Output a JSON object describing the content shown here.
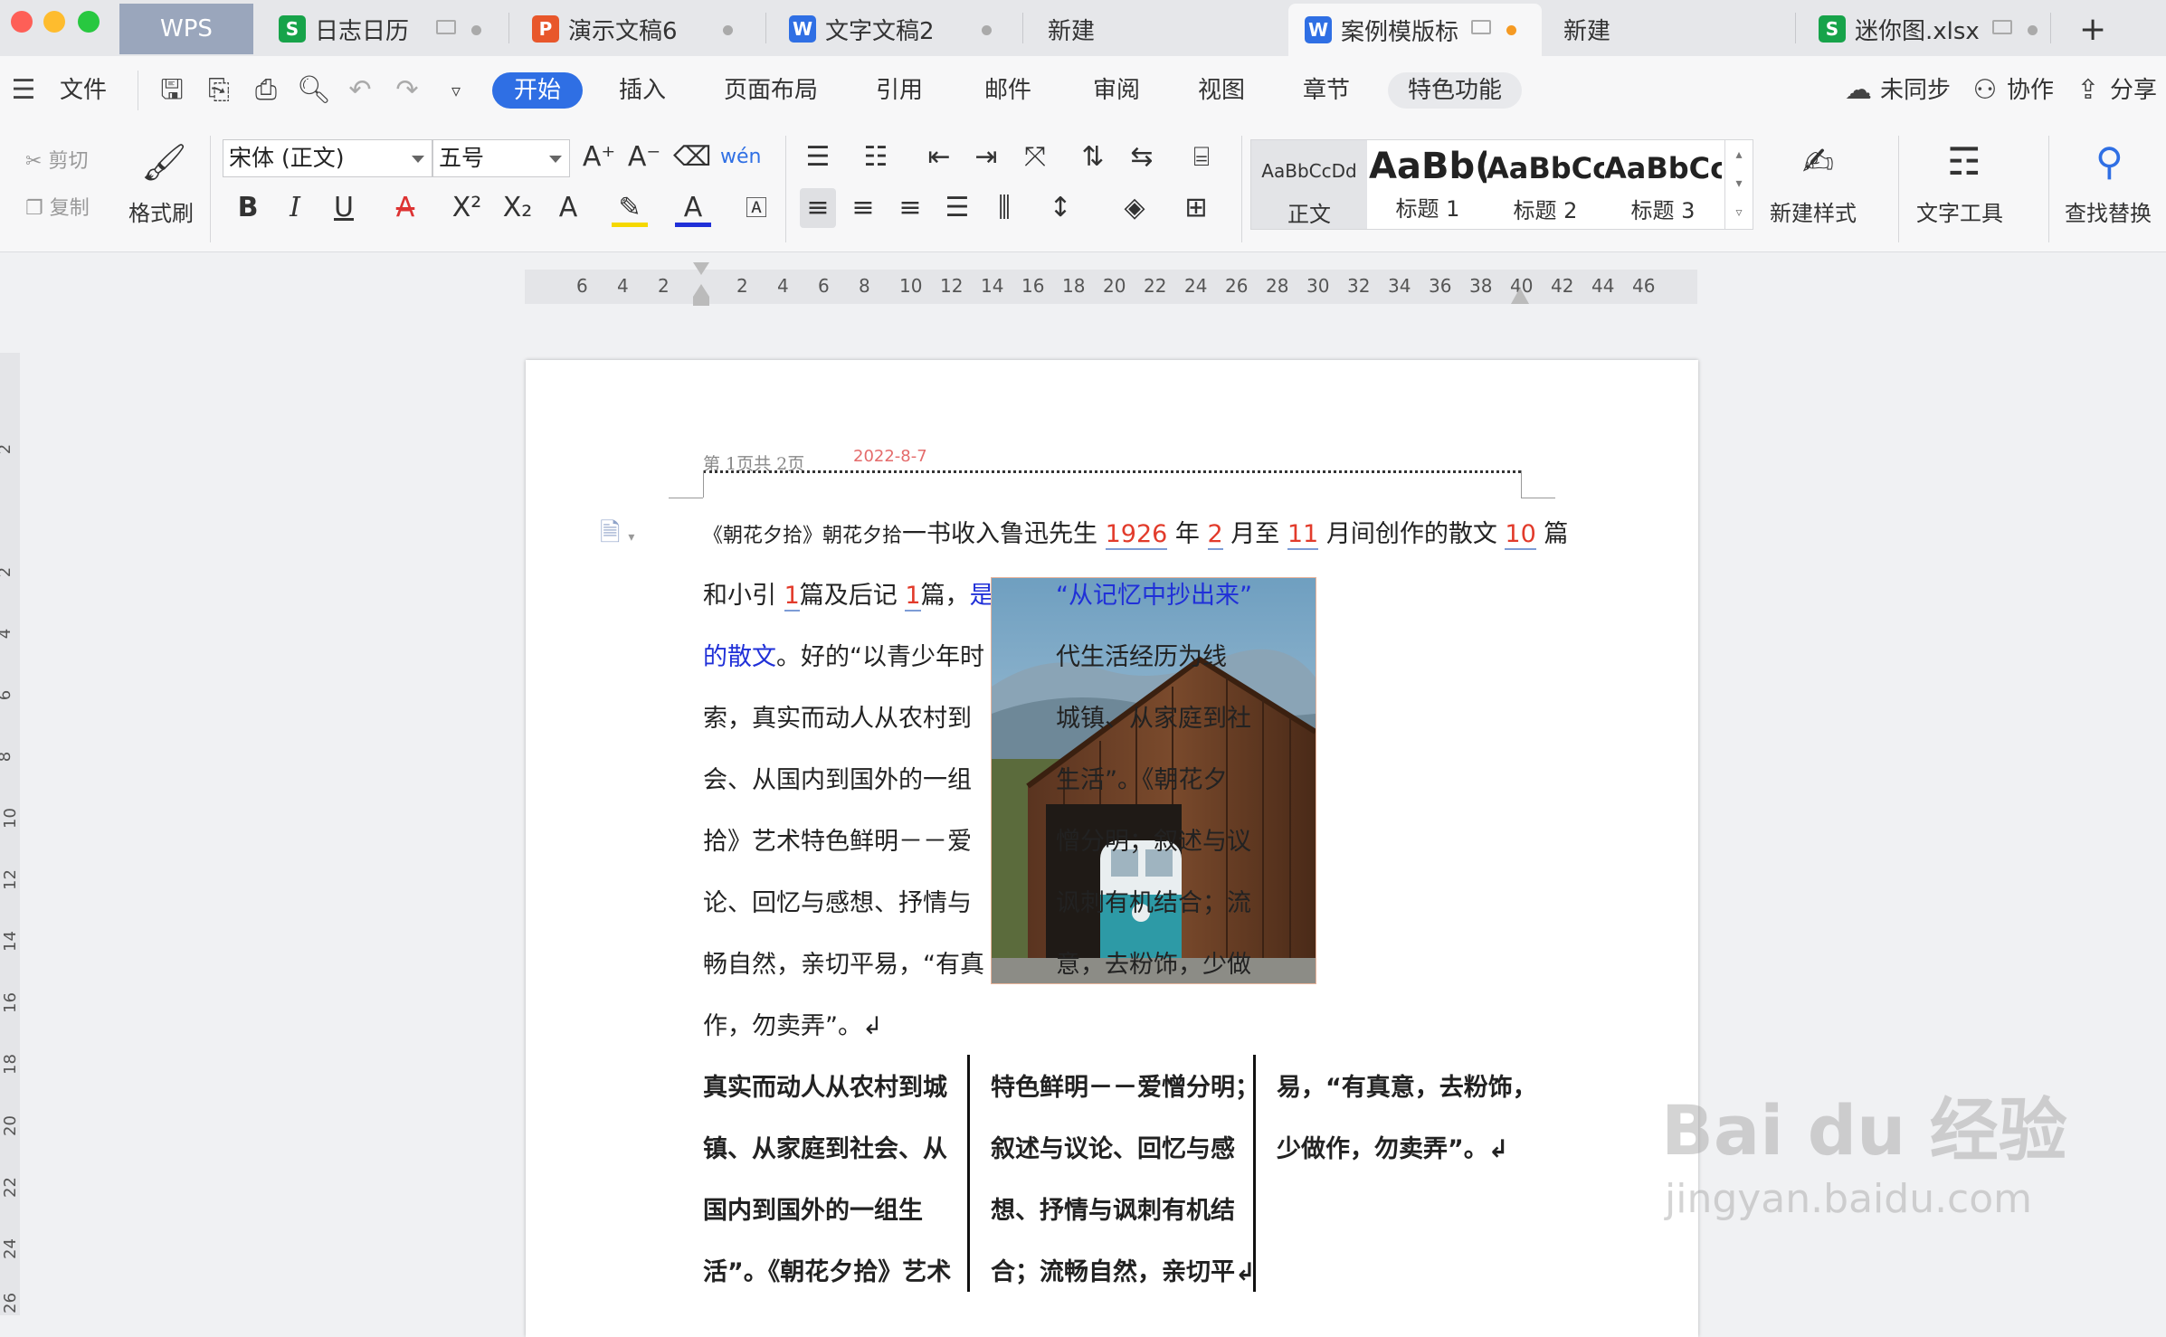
{
  "tabs": {
    "wps": "WPS",
    "items": [
      {
        "label": "日志日历",
        "icon": "S",
        "color": "#17a34a"
      },
      {
        "label": "演示文稿6",
        "icon": "P",
        "color": "#e8572b"
      },
      {
        "label": "文字文稿2",
        "icon": "W",
        "color": "#2f6fe4"
      },
      {
        "label": "新建"
      },
      {
        "label": "案例模版标",
        "icon": "W",
        "color": "#2f6fe4",
        "active": true
      },
      {
        "label": "新建"
      },
      {
        "label": "迷你图.xlsx",
        "icon": "S",
        "color": "#17a34a"
      }
    ],
    "add": "+"
  },
  "menubar": {
    "file": "文件",
    "items": [
      "开始",
      "插入",
      "页面布局",
      "引用",
      "邮件",
      "审阅",
      "视图",
      "章节",
      "特色功能"
    ],
    "unsync": "未同步",
    "collab": "协作",
    "share": "分享"
  },
  "ribbon": {
    "cut": "剪切",
    "copy": "复制",
    "format_painter": "格式刷",
    "font": "宋体 (正文)",
    "size": "五号",
    "styles": [
      {
        "preview": "AaBbCcDd",
        "name": "正文"
      },
      {
        "preview": "AaBb(",
        "name": "标题 1"
      },
      {
        "preview": "AaBbCc",
        "name": "标题 2"
      },
      {
        "preview": "AaBbCc",
        "name": "标题 3"
      }
    ],
    "new_style": "新建样式",
    "text_tools": "文字工具",
    "find_replace": "查找替换"
  },
  "ruler": {
    "h": [
      "6",
      "4",
      "2",
      "2",
      "4",
      "6",
      "8",
      "10",
      "12",
      "14",
      "16",
      "18",
      "20",
      "22",
      "24",
      "26",
      "28",
      "30",
      "32",
      "34",
      "36",
      "38",
      "40",
      "42",
      "44",
      "46"
    ],
    "v": [
      "2",
      "2",
      "4",
      "6",
      "8",
      "10",
      "12",
      "14",
      "16",
      "18",
      "20",
      "22",
      "24",
      "26"
    ]
  },
  "document": {
    "header_page": "第 1页共 2页",
    "header_date": "2022-8-7",
    "line1": {
      "a": "《朝花夕拾》",
      "b": "朝花夕拾",
      "c": "一书收入鲁迅先生 ",
      "y": "1926",
      "d": " 年 ",
      "m": "2",
      "e": " 月至 ",
      "n": "11",
      "f": " 月间创作的散文 ",
      "k": "10",
      "g": " 篇"
    },
    "left_col": [
      {
        "pre": "和小引 ",
        "r1": "1",
        "mid": "篇及后记 ",
        "r2": "1",
        "post": "篇，",
        "blue": "是"
      },
      {
        "blue": "的散文",
        "post": "。好的“以青少年时"
      },
      {
        "text": "索，真实而动人从农村到"
      },
      {
        "text": "会、从国内到国外的一组"
      },
      {
        "text": "拾》艺术特色鲜明－－爱"
      },
      {
        "text": "论、回忆与感想、抒情与"
      },
      {
        "text": "畅自然，亲切平易，“有真"
      },
      {
        "text": "作，勿卖弄”。↲"
      }
    ],
    "right_col": [
      {
        "blue": "“从记忆中抄出来”"
      },
      {
        "text": "代生活经历为线"
      },
      {
        "text": "城镇、从家庭到社"
      },
      {
        "text": "生活”。《朝花夕"
      },
      {
        "text": "憎分明；叙述与议"
      },
      {
        "text": "讽刺有机结合；流"
      },
      {
        "text": "意，去粉饰，少做"
      }
    ],
    "bold_col1": [
      "真实而动人从农村到城",
      "镇、从家庭到社会、从",
      "国内到国外的一组生",
      "活”。《朝花夕拾》艺术"
    ],
    "bold_col2": [
      "特色鲜明－－爱憎分明；",
      "叙述与议论、回忆与感",
      "想、抒情与讽刺有机结",
      "合；流畅自然，亲切平↲"
    ],
    "bold_col3": [
      "易，“有真意，去粉饰，",
      "少做作，勿卖弄”。↲"
    ]
  },
  "watermark": {
    "main": "Bai du 经验",
    "sub": "jingyan.baidu.com"
  }
}
